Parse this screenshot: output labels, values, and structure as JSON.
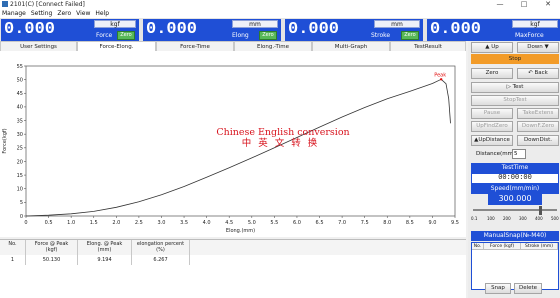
{
  "window": {
    "title": "2101(C)   [Connect Failed]",
    "minimize": "—",
    "maximize": "□",
    "close": "✕"
  },
  "menu": [
    "Manage",
    "Setting",
    "Zero",
    "View",
    "Help"
  ],
  "readouts": {
    "force": {
      "value": "0.000",
      "unit": "kgf",
      "name": "Force",
      "zero": "Zero"
    },
    "elong": {
      "value": "0.000",
      "unit": "mm",
      "name": "Elong",
      "zero": "Zero"
    },
    "stroke": {
      "value": "0.000",
      "unit": "mm",
      "name": "Stroke",
      "zero": "Zero"
    },
    "maxforce": {
      "value": "0.000",
      "unit": "kgf",
      "name": "MaxForce"
    }
  },
  "tabs": [
    "User Settings",
    "Force-Elong.",
    "Force-Time",
    "Elong.-Time",
    "Multi-Graph",
    "TestResult"
  ],
  "active_tab": 1,
  "watermark": {
    "line1": "Chinese English conversion",
    "line2": "中英文转换"
  },
  "chart_data": {
    "type": "line",
    "xlabel": "Elong.(mm)",
    "ylabel": "Force(kgf)",
    "xlim": [
      0,
      9.5
    ],
    "ylim": [
      0,
      55
    ],
    "xticks": [
      "0",
      "0.5",
      "1.0",
      "1.5",
      "2.0",
      "2.5",
      "3.0",
      "3.5",
      "4.0",
      "4.5",
      "5.0",
      "5.5",
      "6.0",
      "6.5",
      "7.0",
      "7.5",
      "8.0",
      "8.5",
      "9.0",
      "9.5"
    ],
    "yticks": [
      "0",
      "5",
      "10",
      "15",
      "20",
      "25",
      "30",
      "35",
      "40",
      "45",
      "50",
      "55"
    ],
    "grid": false,
    "annotation": {
      "label": "Peak",
      "x": 9.194,
      "y": 50.13
    },
    "series": [
      {
        "x": [
          0,
          0.5,
          1.0,
          1.5,
          2.0,
          2.5,
          3.0,
          3.5,
          4.0,
          4.5,
          5.0,
          5.5,
          6.0,
          6.5,
          7.0,
          7.5,
          8.0,
          8.5,
          9.0,
          9.194,
          9.3,
          9.36,
          9.4
        ],
        "y": [
          0,
          0.3,
          0.8,
          1.7,
          3.2,
          5.2,
          7.8,
          10.8,
          14.2,
          17.7,
          21.3,
          25.0,
          28.8,
          32.6,
          36.3,
          39.8,
          43.0,
          45.7,
          48.6,
          50.13,
          48.5,
          43.0,
          34.0
        ]
      }
    ]
  },
  "results": {
    "headers": [
      "No.",
      "Force @ Peak\n(kgf)",
      "Elong. @ Peak\n(mm)",
      "elongation percent\n(%)"
    ],
    "rows": [
      [
        "1",
        "50.130",
        "9.194",
        "6.267"
      ]
    ]
  },
  "side": {
    "up": "Up",
    "down": "Down",
    "stop": "Stop",
    "zero": "Zero",
    "back": "Back",
    "test": "Test",
    "stoptest": "StopTest",
    "pause": "Pause",
    "takeextens": "TakeExtens",
    "upfindzero": "UpFindZero",
    "downfindzero": "DownF.Zero",
    "updistance": "UpDistance",
    "downdistance": "DownDist.",
    "distance_label": "Distance(mm)",
    "distance_value": "5",
    "testtime_label": "TestTime",
    "testtime_value": "00:00:00",
    "speed_label": "Speed(mm/min)",
    "speed_value": "300.000",
    "speed_level": 0.82,
    "speed_scale": [
      "0.1",
      "100",
      "200",
      "300",
      "400",
      "500"
    ],
    "manualsnap_label": "ManualSnap(№-M40)",
    "manualsnap_headers": [
      "No.",
      "Force (kgf)",
      "Stroke (mm)"
    ],
    "snap": "Snap",
    "delete": "Delete"
  },
  "colors": {
    "readout_bg": "#1f4fd6",
    "stop": "#f29b28",
    "watermark": "#d8151f",
    "curve": "#333333",
    "peak_label": "#e01010"
  }
}
